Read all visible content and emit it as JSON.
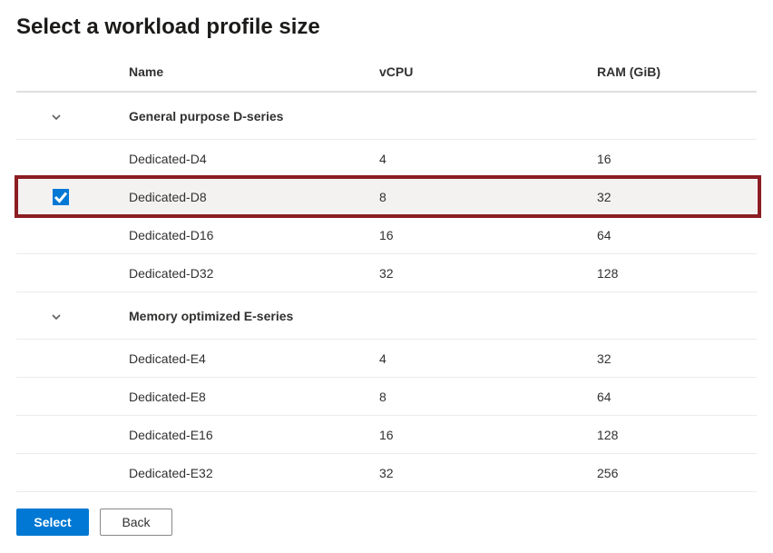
{
  "page": {
    "title": "Select a workload profile size"
  },
  "table": {
    "columns": {
      "name": "Name",
      "vcpu": "vCPU",
      "ram": "RAM (GiB)"
    }
  },
  "groups": [
    {
      "label": "General purpose D-series",
      "rows": [
        {
          "name": "Dedicated-D4",
          "vcpu": "4",
          "ram": "16",
          "selected": false
        },
        {
          "name": "Dedicated-D8",
          "vcpu": "8",
          "ram": "32",
          "selected": true
        },
        {
          "name": "Dedicated-D16",
          "vcpu": "16",
          "ram": "64",
          "selected": false
        },
        {
          "name": "Dedicated-D32",
          "vcpu": "32",
          "ram": "128",
          "selected": false
        }
      ]
    },
    {
      "label": "Memory optimized E-series",
      "rows": [
        {
          "name": "Dedicated-E4",
          "vcpu": "4",
          "ram": "32",
          "selected": false
        },
        {
          "name": "Dedicated-E8",
          "vcpu": "8",
          "ram": "64",
          "selected": false
        },
        {
          "name": "Dedicated-E16",
          "vcpu": "16",
          "ram": "128",
          "selected": false
        },
        {
          "name": "Dedicated-E32",
          "vcpu": "32",
          "ram": "256",
          "selected": false
        }
      ]
    }
  ],
  "footer": {
    "select": "Select",
    "back": "Back"
  },
  "colors": {
    "primary": "#0078d4",
    "highlight_border": "#8b1d23"
  }
}
